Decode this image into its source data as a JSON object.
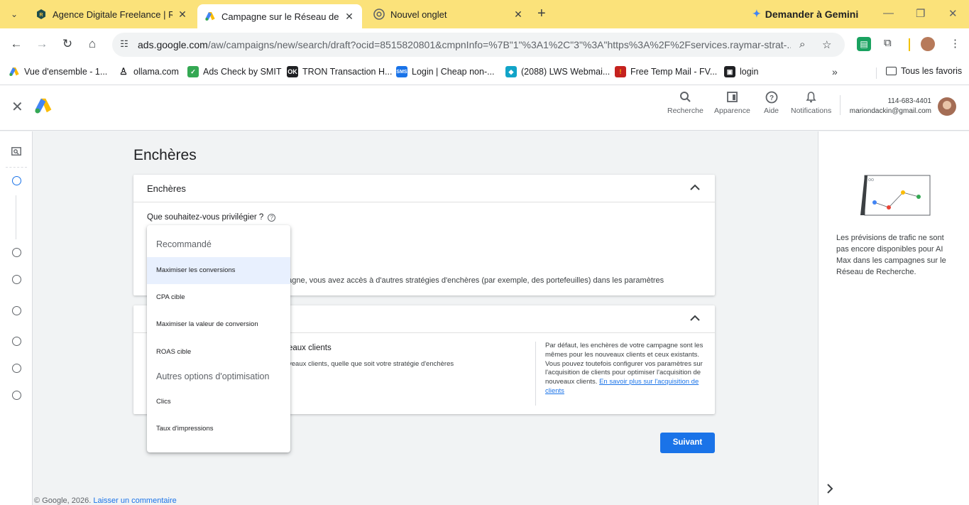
{
  "browser": {
    "tabs": [
      {
        "title": "Agence Digitale Freelance | Raym",
        "active": false
      },
      {
        "title": "Campagne sur le Réseau de Rech",
        "active": true
      },
      {
        "title": "Nouvel onglet",
        "active": false
      }
    ],
    "gemini_label": "Demander à Gemini",
    "url_host": "ads.google.com",
    "url_path": "/aw/campaigns/new/search/draft?ocid=8515820801&cmpnInfo=%7B\"1\"%3A1%2C\"3\"%3A\"https%3A%2F%2Fservices.raymar-strat-...",
    "bookmarks": [
      "Vue d'ensemble - 1...",
      "ollama.com",
      "Ads Check by SMIT",
      "TRON Transaction H...",
      "Login | Cheap non-...",
      "(2088) LWS Webmai...",
      "Free Temp Mail - FV...",
      "login"
    ],
    "bookmarks_all": "Tous les favoris"
  },
  "header": {
    "search": "Recherche",
    "appearance": "Apparence",
    "help": "Aide",
    "notifications": "Notifications",
    "account_id": "114-683-4401",
    "account_email": "mariondackin@gmail.com"
  },
  "main": {
    "title": "Enchères",
    "card1": {
      "title": "Enchères",
      "question": "Que souhaitez-vous privilégier ?",
      "note": "pagne, vous avez accès à d'autres stratégies d'enchères (par exemple, des portefeuilles) dans les paramètres"
    },
    "card2": {
      "title": "eaux clients",
      "subtitle": "veaux clients, quelle que soit votre stratégie d'enchères",
      "info": "Par défaut, les enchères de votre campagne sont les mêmes pour les nouveaux clients et ceux existants. Vous pouvez toutefois configurer vos paramètres sur l'acquisition de clients pour optimiser l'acquisition de nouveaux clients.",
      "info_link": "En savoir plus sur l'acquisition de clients"
    },
    "next_button": "Suivant",
    "footer_copy": "© Google, 2026.",
    "footer_link": "Laisser un commentaire"
  },
  "dropdown": {
    "header_recommended": "Recommandé",
    "recommended": [
      "Maximiser les conversions",
      "CPA cible",
      "Maximiser la valeur de conversion",
      "ROAS cible"
    ],
    "header_other": "Autres options d'optimisation",
    "other": [
      "Clics",
      "Taux d'impressions"
    ]
  },
  "right_panel": {
    "text": "Les prévisions de trafic ne sont pas encore disponibles pour AI Max dans les campagnes sur le Réseau de Recherche."
  },
  "colors": {
    "tabstrip": "#fbe27a",
    "accent": "#1a73e8",
    "selected_bg": "#e8f0fe"
  }
}
